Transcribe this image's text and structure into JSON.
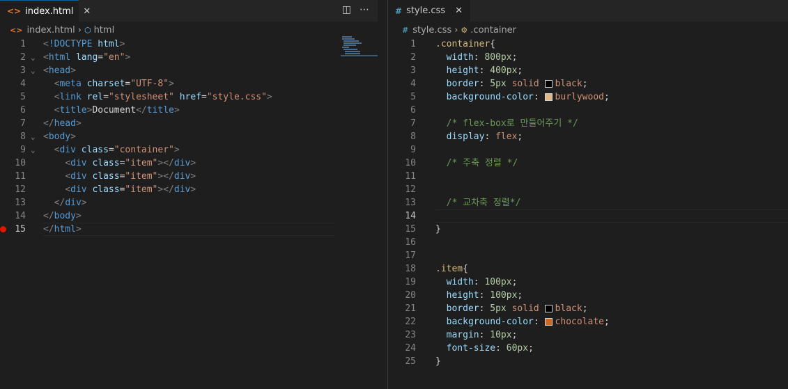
{
  "left": {
    "tab": {
      "icon": "<>",
      "label": "index.html",
      "close": "✕"
    },
    "actions": [
      "split-editor-icon",
      "more-actions-icon"
    ],
    "breadcrumb": [
      "index.html",
      "html"
    ],
    "lines": [
      {
        "n": "1",
        "tokens": [
          [
            "t-punct",
            "<"
          ],
          [
            "t-tag",
            "!DOCTYPE "
          ],
          [
            "t-attr",
            "html"
          ],
          [
            "t-punct",
            ">"
          ]
        ]
      },
      {
        "n": "2",
        "tokens": [
          [
            "t-punct",
            "<"
          ],
          [
            "t-tag",
            "html "
          ],
          [
            "t-attr",
            "lang"
          ],
          [
            "t-text",
            "="
          ],
          [
            "t-str",
            "\"en\""
          ],
          [
            "t-punct",
            ">"
          ]
        ]
      },
      {
        "n": "3",
        "tokens": [
          [
            "t-punct",
            "<"
          ],
          [
            "t-tag",
            "head"
          ],
          [
            "t-punct",
            ">"
          ]
        ]
      },
      {
        "n": "4",
        "tokens": [
          [
            "t-text",
            "  "
          ],
          [
            "t-punct",
            "<"
          ],
          [
            "t-tag",
            "meta "
          ],
          [
            "t-attr",
            "charset"
          ],
          [
            "t-text",
            "="
          ],
          [
            "t-str",
            "\"UTF-8\""
          ],
          [
            "t-punct",
            ">"
          ]
        ]
      },
      {
        "n": "5",
        "tokens": [
          [
            "t-text",
            "  "
          ],
          [
            "t-punct",
            "<"
          ],
          [
            "t-tag",
            "link "
          ],
          [
            "t-attr",
            "rel"
          ],
          [
            "t-text",
            "="
          ],
          [
            "t-str",
            "\"stylesheet\""
          ],
          [
            "t-text",
            " "
          ],
          [
            "t-attr",
            "href"
          ],
          [
            "t-text",
            "="
          ],
          [
            "t-str",
            "\"style.css\""
          ],
          [
            "t-punct",
            ">"
          ]
        ]
      },
      {
        "n": "6",
        "tokens": [
          [
            "t-text",
            "  "
          ],
          [
            "t-punct",
            "<"
          ],
          [
            "t-tag",
            "title"
          ],
          [
            "t-punct",
            ">"
          ],
          [
            "t-text",
            "Document"
          ],
          [
            "t-punct",
            "</"
          ],
          [
            "t-tag",
            "title"
          ],
          [
            "t-punct",
            ">"
          ]
        ]
      },
      {
        "n": "7",
        "tokens": [
          [
            "t-punct",
            "</"
          ],
          [
            "t-tag",
            "head"
          ],
          [
            "t-punct",
            ">"
          ]
        ]
      },
      {
        "n": "8",
        "tokens": [
          [
            "t-punct",
            "<"
          ],
          [
            "t-tag",
            "body"
          ],
          [
            "t-punct",
            ">"
          ]
        ]
      },
      {
        "n": "9",
        "tokens": [
          [
            "t-text",
            "  "
          ],
          [
            "t-punct",
            "<"
          ],
          [
            "t-tag",
            "div "
          ],
          [
            "t-attr",
            "class"
          ],
          [
            "t-text",
            "="
          ],
          [
            "t-str",
            "\"container\""
          ],
          [
            "t-punct",
            ">"
          ]
        ]
      },
      {
        "n": "10",
        "tokens": [
          [
            "t-text",
            "    "
          ],
          [
            "t-punct",
            "<"
          ],
          [
            "t-tag",
            "div "
          ],
          [
            "t-attr",
            "class"
          ],
          [
            "t-text",
            "="
          ],
          [
            "t-str",
            "\"item\""
          ],
          [
            "t-punct",
            "></"
          ],
          [
            "t-tag",
            "div"
          ],
          [
            "t-punct",
            ">"
          ]
        ]
      },
      {
        "n": "11",
        "tokens": [
          [
            "t-text",
            "    "
          ],
          [
            "t-punct",
            "<"
          ],
          [
            "t-tag",
            "div "
          ],
          [
            "t-attr",
            "class"
          ],
          [
            "t-text",
            "="
          ],
          [
            "t-str",
            "\"item\""
          ],
          [
            "t-punct",
            "></"
          ],
          [
            "t-tag",
            "div"
          ],
          [
            "t-punct",
            ">"
          ]
        ]
      },
      {
        "n": "12",
        "tokens": [
          [
            "t-text",
            "    "
          ],
          [
            "t-punct",
            "<"
          ],
          [
            "t-tag",
            "div "
          ],
          [
            "t-attr",
            "class"
          ],
          [
            "t-text",
            "="
          ],
          [
            "t-str",
            "\"item\""
          ],
          [
            "t-punct",
            "></"
          ],
          [
            "t-tag",
            "div"
          ],
          [
            "t-punct",
            ">"
          ]
        ]
      },
      {
        "n": "13",
        "tokens": [
          [
            "t-text",
            "  "
          ],
          [
            "t-punct",
            "</"
          ],
          [
            "t-tag",
            "div"
          ],
          [
            "t-punct",
            ">"
          ]
        ]
      },
      {
        "n": "14",
        "tokens": [
          [
            "t-punct",
            "</"
          ],
          [
            "t-tag",
            "body"
          ],
          [
            "t-punct",
            ">"
          ]
        ]
      },
      {
        "n": "15",
        "tokens": [
          [
            "t-punct",
            "</"
          ],
          [
            "t-tag",
            "html"
          ],
          [
            "t-punct",
            ">"
          ]
        ]
      }
    ]
  },
  "right": {
    "tab": {
      "icon": "#",
      "label": "style.css",
      "close": "✕"
    },
    "breadcrumb": [
      "style.css",
      ".container"
    ],
    "lines": [
      {
        "n": "1",
        "tokens": [
          [
            "t-sel",
            ".container"
          ],
          [
            "t-text",
            "{"
          ]
        ]
      },
      {
        "n": "2",
        "tokens": [
          [
            "t-text",
            "  "
          ],
          [
            "t-prop",
            "width"
          ],
          [
            "t-text",
            ": "
          ],
          [
            "t-num",
            "800px"
          ],
          [
            "t-text",
            ";"
          ]
        ]
      },
      {
        "n": "3",
        "tokens": [
          [
            "t-text",
            "  "
          ],
          [
            "t-prop",
            "height"
          ],
          [
            "t-text",
            ": "
          ],
          [
            "t-num",
            "400px"
          ],
          [
            "t-text",
            ";"
          ]
        ]
      },
      {
        "n": "4",
        "tokens": [
          [
            "t-text",
            "  "
          ],
          [
            "t-prop",
            "border"
          ],
          [
            "t-text",
            ": "
          ],
          [
            "t-num",
            "5px "
          ],
          [
            "t-val",
            "solid "
          ],
          [
            "swatch",
            "#000000"
          ],
          [
            "t-val",
            "black"
          ],
          [
            "t-text",
            ";"
          ]
        ]
      },
      {
        "n": "5",
        "tokens": [
          [
            "t-text",
            "  "
          ],
          [
            "t-prop",
            "background-color"
          ],
          [
            "t-text",
            ": "
          ],
          [
            "swatch",
            "#deb887"
          ],
          [
            "t-val",
            "burlywood"
          ],
          [
            "t-text",
            ";"
          ]
        ]
      },
      {
        "n": "6",
        "tokens": []
      },
      {
        "n": "7",
        "tokens": [
          [
            "t-text",
            "  "
          ],
          [
            "t-comment",
            "/* flex-box로 만들어주기 */"
          ]
        ]
      },
      {
        "n": "8",
        "tokens": [
          [
            "t-text",
            "  "
          ],
          [
            "t-prop",
            "display"
          ],
          [
            "t-text",
            ": "
          ],
          [
            "t-val",
            "flex"
          ],
          [
            "t-text",
            ";"
          ]
        ]
      },
      {
        "n": "9",
        "tokens": []
      },
      {
        "n": "10",
        "tokens": [
          [
            "t-text",
            "  "
          ],
          [
            "t-comment",
            "/* 주축 정렬 */"
          ]
        ]
      },
      {
        "n": "11",
        "tokens": []
      },
      {
        "n": "12",
        "tokens": []
      },
      {
        "n": "13",
        "tokens": [
          [
            "t-text",
            "  "
          ],
          [
            "t-comment",
            "/* 교차축 정렬*/"
          ]
        ]
      },
      {
        "n": "14",
        "tokens": []
      },
      {
        "n": "15",
        "tokens": [
          [
            "t-text",
            "}"
          ]
        ]
      },
      {
        "n": "16",
        "tokens": []
      },
      {
        "n": "17",
        "tokens": []
      },
      {
        "n": "18",
        "tokens": [
          [
            "t-sel",
            ".item"
          ],
          [
            "t-text",
            "{"
          ]
        ]
      },
      {
        "n": "19",
        "tokens": [
          [
            "t-text",
            "  "
          ],
          [
            "t-prop",
            "width"
          ],
          [
            "t-text",
            ": "
          ],
          [
            "t-num",
            "100px"
          ],
          [
            "t-text",
            ";"
          ]
        ]
      },
      {
        "n": "20",
        "tokens": [
          [
            "t-text",
            "  "
          ],
          [
            "t-prop",
            "height"
          ],
          [
            "t-text",
            ": "
          ],
          [
            "t-num",
            "100px"
          ],
          [
            "t-text",
            ";"
          ]
        ]
      },
      {
        "n": "21",
        "tokens": [
          [
            "t-text",
            "  "
          ],
          [
            "t-prop",
            "border"
          ],
          [
            "t-text",
            ": "
          ],
          [
            "t-num",
            "5px "
          ],
          [
            "t-val",
            "solid "
          ],
          [
            "swatch",
            "#000000"
          ],
          [
            "t-val",
            "black"
          ],
          [
            "t-text",
            ";"
          ]
        ]
      },
      {
        "n": "22",
        "tokens": [
          [
            "t-text",
            "  "
          ],
          [
            "t-prop",
            "background-color"
          ],
          [
            "t-text",
            ": "
          ],
          [
            "swatch",
            "#d2691e"
          ],
          [
            "t-val",
            "chocolate"
          ],
          [
            "t-text",
            ";"
          ]
        ]
      },
      {
        "n": "23",
        "tokens": [
          [
            "t-text",
            "  "
          ],
          [
            "t-prop",
            "margin"
          ],
          [
            "t-text",
            ": "
          ],
          [
            "t-num",
            "10px"
          ],
          [
            "t-text",
            ";"
          ]
        ]
      },
      {
        "n": "24",
        "tokens": [
          [
            "t-text",
            "  "
          ],
          [
            "t-prop",
            "font-size"
          ],
          [
            "t-text",
            ": "
          ],
          [
            "t-num",
            "60px"
          ],
          [
            "t-text",
            ";"
          ]
        ]
      },
      {
        "n": "25",
        "tokens": [
          [
            "t-text",
            "}"
          ]
        ]
      }
    ]
  }
}
